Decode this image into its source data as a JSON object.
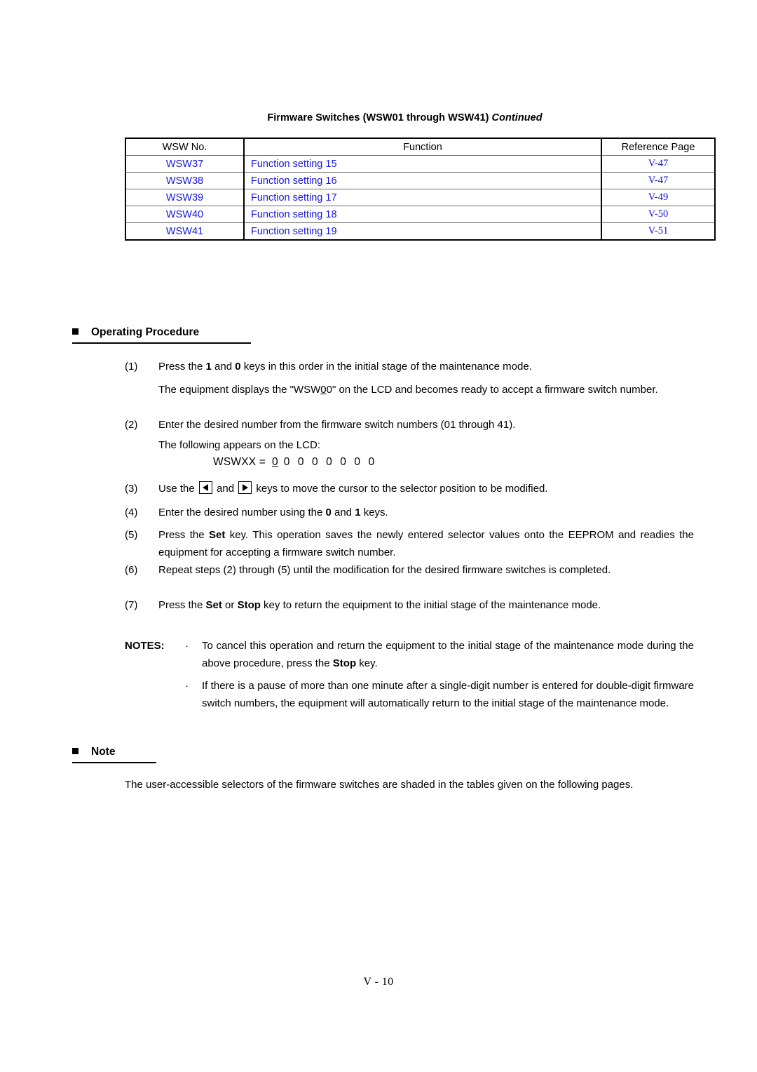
{
  "table": {
    "caption_main": "Firmware Switches (WSW01 through WSW41) ",
    "caption_continued": "Continued",
    "headers": [
      "WSW No.",
      "Function",
      "Reference Page"
    ],
    "rows": [
      {
        "no": "WSW37",
        "function": "Function setting 15",
        "ref": "V-47"
      },
      {
        "no": "WSW38",
        "function": "Function setting 16",
        "ref": "V-47"
      },
      {
        "no": "WSW39",
        "function": "Function setting 17",
        "ref": "V-49"
      },
      {
        "no": "WSW40",
        "function": "Function setting 18",
        "ref": "V-50"
      },
      {
        "no": "WSW41",
        "function": "Function setting 19",
        "ref": "V-51"
      }
    ],
    "link_color": "#1414e6"
  },
  "operating_procedure": {
    "heading": "Operating Procedure",
    "steps": [
      {
        "num": "(1)",
        "pre": "Press the ",
        "key1": "1",
        "mid": " and ",
        "key2": "0",
        "post": " keys in this order in the initial stage of the maintenance mode."
      },
      {
        "num": "(2)",
        "text": "Enter the desired number from the firmware switch numbers (01 through 41)."
      },
      {
        "num": "(3)",
        "pre": "Use the ",
        "mid": " and ",
        "post": " keys to move the cursor to the selector position to be modified."
      },
      {
        "num": "(4)",
        "pre": "Enter the desired number using the ",
        "key1": "0",
        "mid": " and ",
        "key2": "1",
        "post": " keys."
      },
      {
        "num": "(5)",
        "pre": "Press the ",
        "key1": "Set",
        "post": " key.  This operation saves the newly entered selector values onto the EEPROM and readies the equipment for accepting a firmware switch number."
      },
      {
        "num": "(6)",
        "text": "Repeat steps (2) through (5) until the modification for the desired firmware switches is completed."
      },
      {
        "num": "(7)",
        "pre": "Press the ",
        "key1": "Set",
        "mid": " or ",
        "key2": "Stop",
        "post": " key to return the equipment to the initial stage of the maintenance mode."
      }
    ],
    "para_after_1_pre": "The equipment displays the \"WSW",
    "para_after_1_underlined": "0",
    "para_after_1_post": "0\" on the LCD and becomes ready to accept a firmware switch number.",
    "para_after_2": "The following appears on the LCD:",
    "lcd_label": "WSWXX =  ",
    "lcd_first_zero": "0",
    "lcd_rest_zeros": " 0 0 0 0 0 0 0",
    "arrow_left_glyph": "◀",
    "arrow_right_glyph": "▶"
  },
  "notes": {
    "label": "NOTES:",
    "bullet": "·",
    "items": [
      {
        "pre": "To cancel this operation and return the equipment to the initial stage of the maintenance mode during the above procedure, press the ",
        "key": "Stop",
        "post": " key."
      },
      {
        "pre": "If there is a pause of more than one minute after a single-digit number is entered for double-digit firmware switch numbers, the equipment will automatically return to the initial stage of the maintenance mode.",
        "key": "",
        "post": ""
      }
    ]
  },
  "note_section": {
    "heading": "Note",
    "body": "The user-accessible selectors of the firmware switches are shaded in the tables given on the following pages."
  },
  "footer": {
    "page": "V - 10"
  }
}
